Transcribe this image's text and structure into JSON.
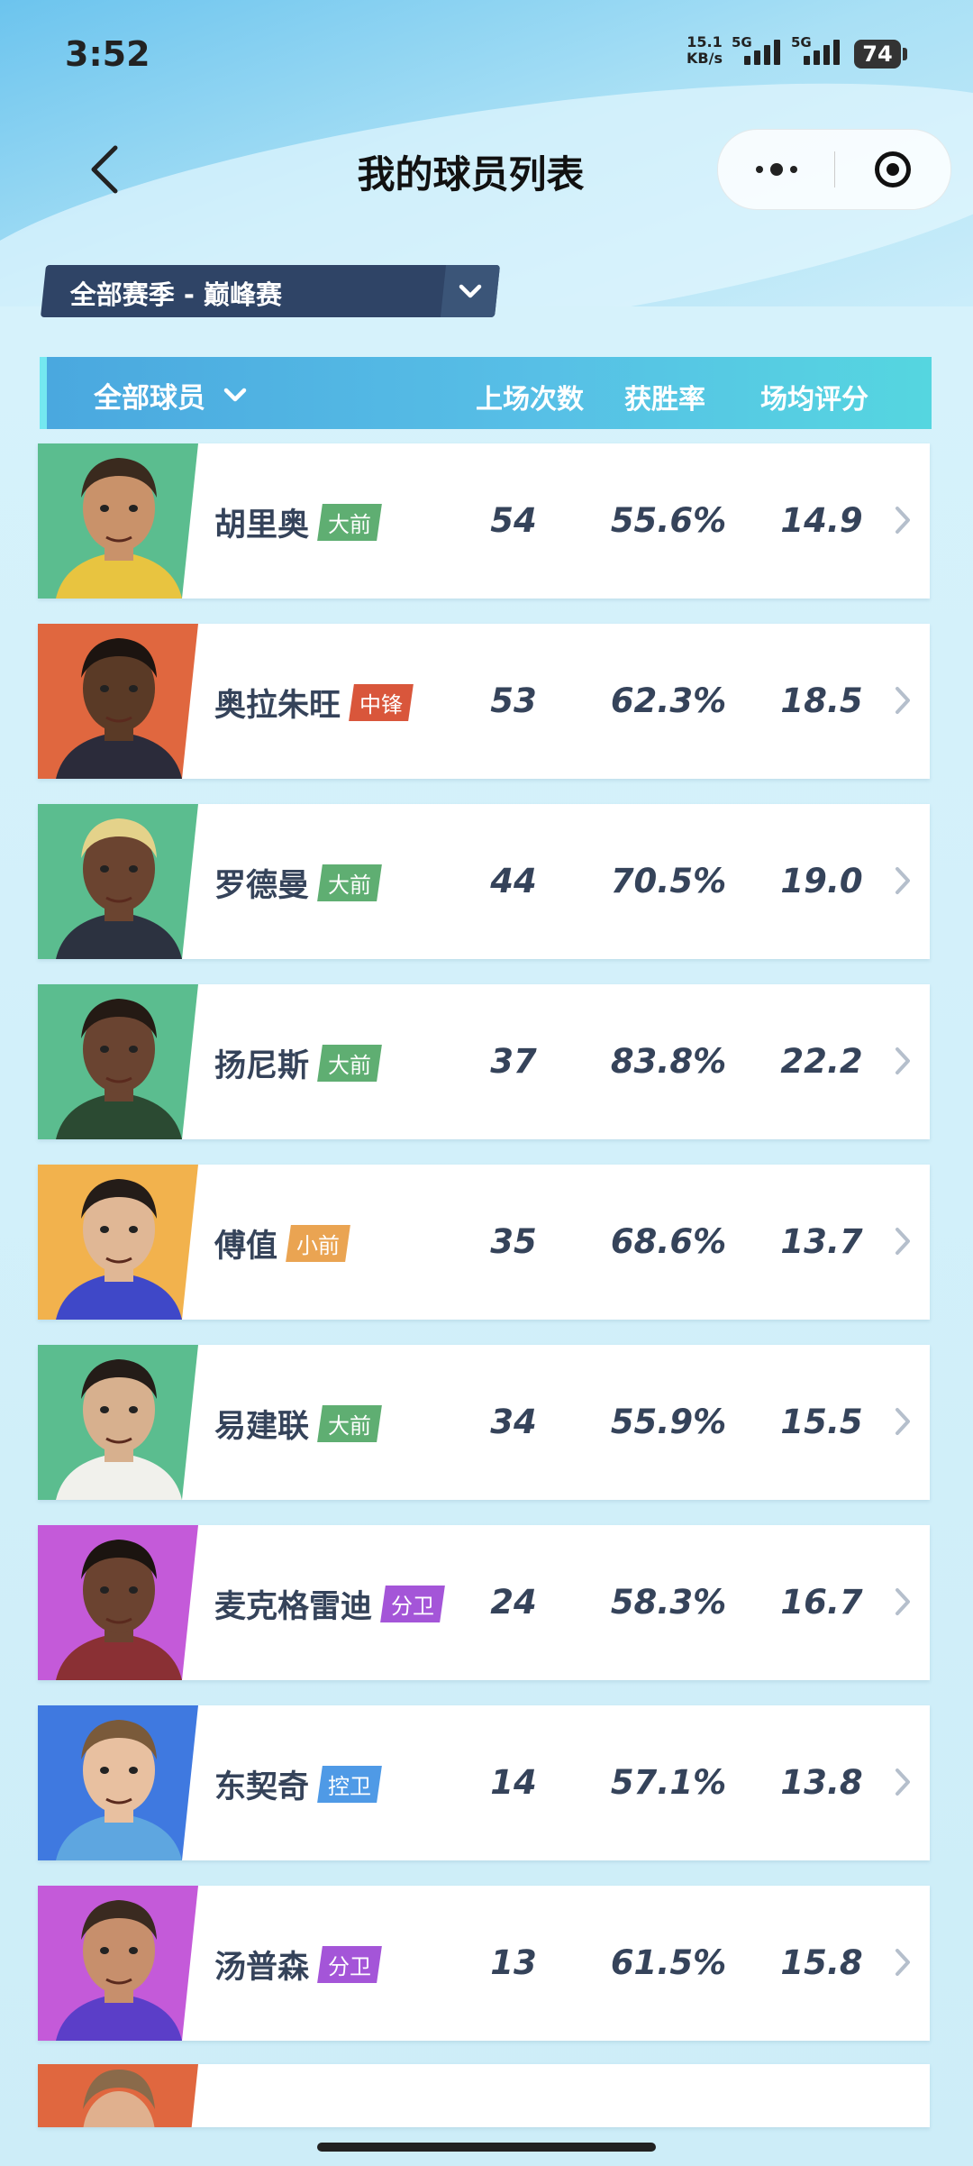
{
  "status_bar": {
    "time": "3:52",
    "speed_value": "15.1",
    "speed_unit": "KB/s",
    "network_1": "5G",
    "network_2": "5G",
    "battery": "74"
  },
  "header": {
    "title": "我的球员列表"
  },
  "season_select": {
    "value": "全部赛季 - 巅峰赛"
  },
  "table": {
    "filter_label": "全部球员",
    "columns": {
      "games": "上场次数",
      "win_rate": "获胜率",
      "avg_score": "场均评分"
    }
  },
  "players": [
    {
      "name": "胡里奥",
      "position": "大前",
      "games": "54",
      "win_rate": "55.6%",
      "avg_score": "14.9",
      "position_color": "#5fae72",
      "avatar_bg": "#5bbd8f"
    },
    {
      "name": "奥拉朱旺",
      "position": "中锋",
      "games": "53",
      "win_rate": "62.3%",
      "avg_score": "18.5",
      "position_color": "#d9563b",
      "avatar_bg": "#e0673f"
    },
    {
      "name": "罗德曼",
      "position": "大前",
      "games": "44",
      "win_rate": "70.5%",
      "avg_score": "19.0",
      "position_color": "#5fae72",
      "avatar_bg": "#5bbd8f"
    },
    {
      "name": "扬尼斯",
      "position": "大前",
      "games": "37",
      "win_rate": "83.8%",
      "avg_score": "22.2",
      "position_color": "#5fae72",
      "avatar_bg": "#5bbd8f"
    },
    {
      "name": "傅值",
      "position": "小前",
      "games": "35",
      "win_rate": "68.6%",
      "avg_score": "13.7",
      "position_color": "#eaa452",
      "avatar_bg": "#f2b24d"
    },
    {
      "name": "易建联",
      "position": "大前",
      "games": "34",
      "win_rate": "55.9%",
      "avg_score": "15.5",
      "position_color": "#5fae72",
      "avatar_bg": "#5bbd8f"
    },
    {
      "name": "麦克格雷迪",
      "position": "分卫",
      "games": "24",
      "win_rate": "58.3%",
      "avg_score": "16.7",
      "position_color": "#a455d8",
      "avatar_bg": "#c45ad9"
    },
    {
      "name": "东契奇",
      "position": "控卫",
      "games": "14",
      "win_rate": "57.1%",
      "avg_score": "13.8",
      "position_color": "#4f9ae6",
      "avatar_bg": "#3f79e0"
    },
    {
      "name": "汤普森",
      "position": "分卫",
      "games": "13",
      "win_rate": "61.5%",
      "avg_score": "15.8",
      "position_color": "#a455d8",
      "avatar_bg": "#c45ad9"
    }
  ],
  "partial_row": {
    "avatar_bg": "#e0673f"
  }
}
